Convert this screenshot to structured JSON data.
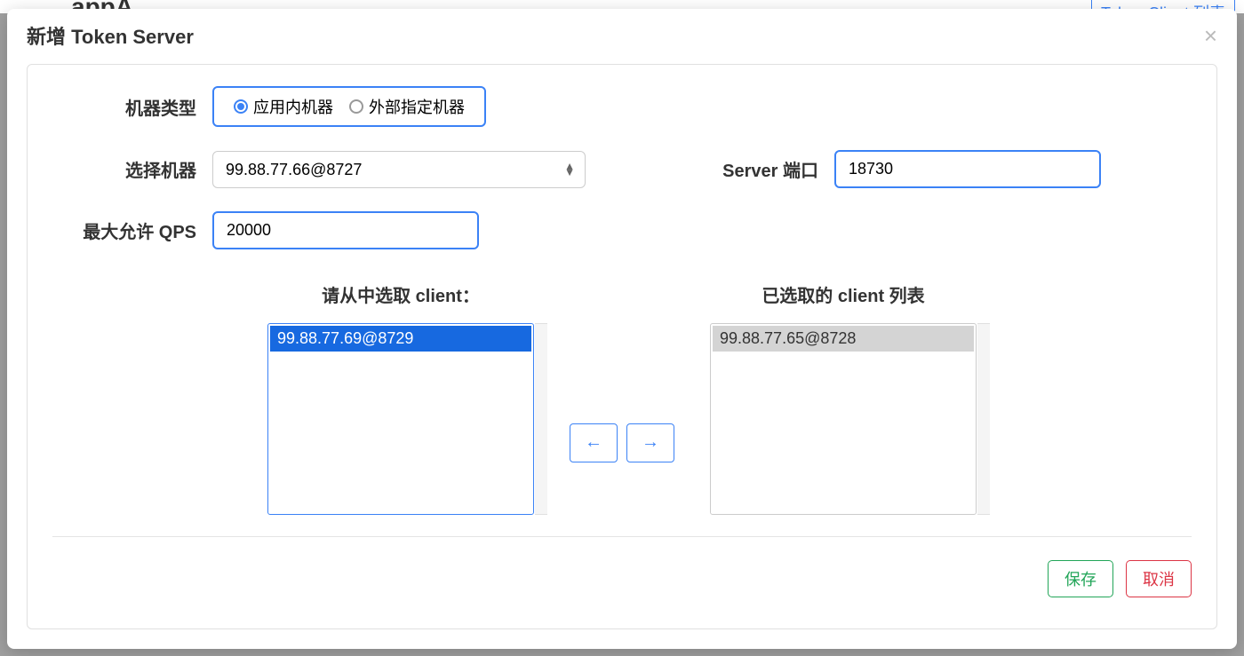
{
  "background": {
    "appTitle": "appA",
    "tabLabel": "Token Client 列表"
  },
  "modal": {
    "title": "新增 Token Server",
    "form": {
      "machineTypeLabel": "机器类型",
      "radioOption1": "应用内机器",
      "radioOption2": "外部指定机器",
      "selectMachineLabel": "选择机器",
      "selectMachineValue": "99.88.77.66@8727",
      "serverPortLabel": "Server 端口",
      "serverPortValue": "18730",
      "maxQpsLabel": "最大允许 QPS",
      "maxQpsValue": "20000"
    },
    "transfer": {
      "availableTitle": "请从中选取 client：",
      "selectedTitle": "已选取的 client 列表",
      "availableItems": [
        "99.88.77.69@8729"
      ],
      "selectedItems": [
        "99.88.77.65@8728"
      ],
      "moveLeftLabel": "←",
      "moveRightLabel": "→"
    },
    "footer": {
      "saveLabel": "保存",
      "cancelLabel": "取消"
    }
  }
}
